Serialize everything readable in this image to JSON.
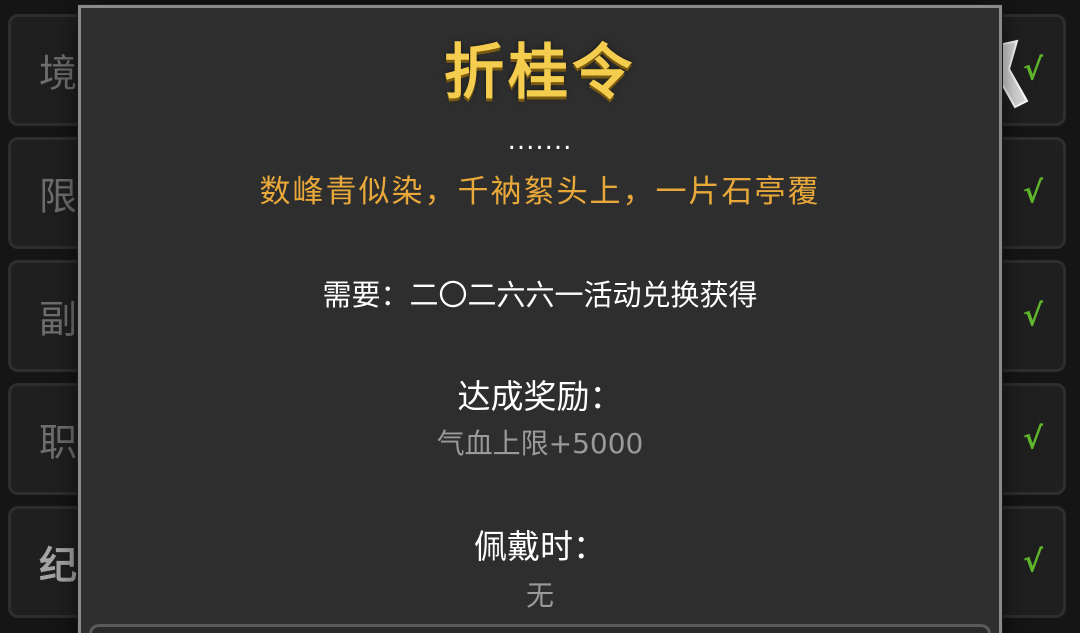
{
  "background_list": {
    "rows": [
      {
        "label": "境",
        "status": "√",
        "bold": false
      },
      {
        "label": "限",
        "status": "√",
        "bold": false
      },
      {
        "label": "副",
        "status": "√",
        "bold": false
      },
      {
        "label": "职",
        "status": "√",
        "bold": false
      },
      {
        "label": "纪",
        "status": "√",
        "bold": true
      }
    ],
    "check_color": "#5fb52c"
  },
  "modal": {
    "title": "折桂令",
    "ellipsis": ".......",
    "poem": "数峰青似染，千衲絮头上，一片石亭覆",
    "requirement": "需要：二〇二六六一活动兑换获得",
    "reward_heading": "达成奖励：",
    "reward_value": "气血上限+5000",
    "wear_heading": "佩戴时：",
    "wear_value": "无",
    "title_color": "#f4cd4e",
    "poem_color": "#e9a83a"
  }
}
